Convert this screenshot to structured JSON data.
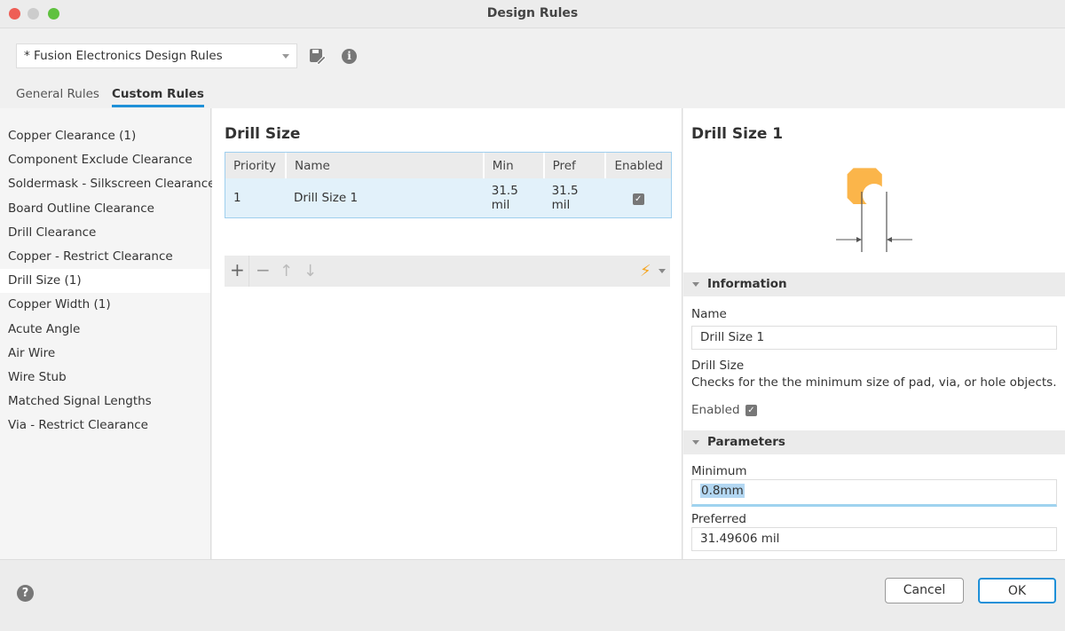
{
  "window": {
    "title": "Design Rules"
  },
  "header": {
    "ruleset": "* Fusion Electronics Design Rules",
    "save_icon": "save-edit-icon",
    "info_icon": "info-icon"
  },
  "tabs": [
    {
      "label": "General Rules"
    },
    {
      "label": "Custom Rules",
      "active": true
    }
  ],
  "sidebar": {
    "items": [
      {
        "label": "Copper Clearance (1)"
      },
      {
        "label": "Component Exclude Clearance"
      },
      {
        "label": "Soldermask - Silkscreen Clearance"
      },
      {
        "label": "Board Outline Clearance"
      },
      {
        "label": "Drill Clearance"
      },
      {
        "label": "Copper - Restrict Clearance"
      },
      {
        "label": "Drill Size (1)",
        "selected": true
      },
      {
        "label": "Copper Width (1)"
      },
      {
        "label": "Acute Angle"
      },
      {
        "label": "Air Wire"
      },
      {
        "label": "Wire Stub"
      },
      {
        "label": "Matched Signal Lengths"
      },
      {
        "label": "Via - Restrict Clearance"
      }
    ]
  },
  "middle": {
    "title": "Drill Size",
    "columns": [
      "Priority",
      "Name",
      "Min",
      "Pref",
      "Enabled"
    ],
    "rows": [
      {
        "priority": "1",
        "name": "Drill Size 1",
        "min": "31.5 mil",
        "pref": "31.5 mil",
        "enabled": true
      }
    ]
  },
  "details": {
    "title": "Drill Size 1",
    "info_section": "Information",
    "name_label": "Name",
    "name_value": "Drill Size 1",
    "rule_type": "Drill Size",
    "description": "Checks for the the minimum size of pad, via, or hole objects.",
    "enabled_label": "Enabled",
    "enabled": true,
    "params_section": "Parameters",
    "minimum_label": "Minimum",
    "minimum_value": "0.8mm",
    "preferred_label": "Preferred",
    "preferred_value": "31.49606 mil"
  },
  "footer": {
    "cancel": "Cancel",
    "ok": "OK"
  },
  "colors": {
    "accent": "#1e90d8",
    "pad": "#fbb54a"
  }
}
